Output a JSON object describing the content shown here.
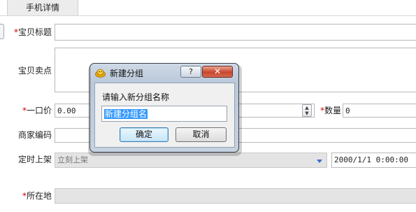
{
  "tab": {
    "label": "手机详情"
  },
  "form": {
    "title_label": "宝贝标题",
    "selling_points_label": "宝贝卖点",
    "price_label": "一口价",
    "price_value": "0.00",
    "quantity_label": "数量",
    "quantity_value": "0",
    "merchant_code_label": "商家编码",
    "scheduled_label": "定时上架",
    "scheduled_option": "立刻上架",
    "scheduled_datetime": "2000/1/1 0:00:00",
    "location_label": "所在地",
    "required_mark": "*"
  },
  "dialog": {
    "title": "新建分组",
    "help_glyph": "?",
    "close_glyph": "✕",
    "prompt": "请输入新分组名称",
    "input_value": "新建分组名",
    "ok_label": "确定",
    "cancel_label": "取消"
  },
  "colors": {
    "required": "#d40000",
    "selection": "#3399ff",
    "close_button": "#c8462e"
  },
  "icons": {
    "dialog_app": "yellow-smiley-icon",
    "spinner": "spin-up-down-icon",
    "dropdown": "chevron-down-icon"
  }
}
